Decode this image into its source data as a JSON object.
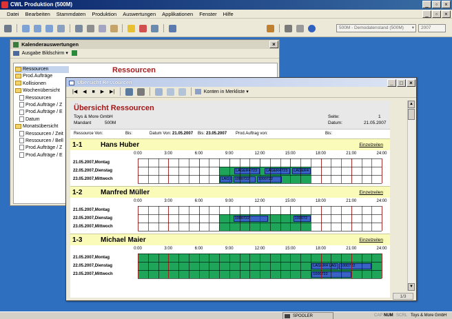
{
  "app": {
    "title": "CWL Produktion (500M)"
  },
  "menu": [
    "Datei",
    "Bearbeiten",
    "Stammdaten",
    "Produktion",
    "Auswertungen",
    "Applikationen",
    "Fenster",
    "Hilfe"
  ],
  "toolbar": {
    "database_label": "500M - Demodatenstand (500M)",
    "year": "2007"
  },
  "kalender": {
    "title": "Kalenderauswertungen",
    "output_label": "Ausgabe Bildschirm",
    "heading": "Ressourcen",
    "tree": [
      {
        "label": "Ressourcen",
        "level": 0,
        "type": "folder"
      },
      {
        "label": "Prod.Aufträge",
        "level": 0,
        "type": "folder"
      },
      {
        "label": "Kollisionen",
        "level": 0,
        "type": "folder"
      },
      {
        "label": "Wochenübersicht",
        "level": 0,
        "type": "folder"
      },
      {
        "label": "Ressourcen",
        "level": 1,
        "type": "doc"
      },
      {
        "label": "Prod.Aufträge / Z",
        "level": 1,
        "type": "doc"
      },
      {
        "label": "Prod.Aufträge / E",
        "level": 1,
        "type": "doc"
      },
      {
        "label": "Datum",
        "level": 1,
        "type": "doc"
      },
      {
        "label": "Monatsübersicht",
        "level": 0,
        "type": "folder"
      },
      {
        "label": "Ressourcen / Zeit",
        "level": 1,
        "type": "doc"
      },
      {
        "label": "Ressourcen / Bell",
        "level": 1,
        "type": "doc"
      },
      {
        "label": "Prod.Aufträge / Z",
        "level": 1,
        "type": "doc"
      },
      {
        "label": "Prod.Aufträge / E",
        "level": 1,
        "type": "doc"
      }
    ]
  },
  "uebersicht": {
    "title": "Übersicht Ressourcen",
    "toolbar_dropdown": "Konten in Merkliste",
    "page_indicator": "1/3",
    "report": {
      "title": "Übersicht Ressourcen",
      "company": "Toys & More GmbH",
      "mandant_label": "Mandant",
      "mandant_value": "500M",
      "seite_label": "Seite:",
      "seite_value": "1",
      "datum_label": "Datum:",
      "datum_value": "21.05.2007",
      "filter": {
        "ressource_von": "Ressource Von:",
        "bis": "Bis:",
        "datum_von_label": "Datum Von:",
        "datum_von": "21.05.2007",
        "bis2_label": "Bis:",
        "datum_bis": "23.05.2007",
        "prodauftrag_label": "Prod.Auftrag von:",
        "bis3": "Bis:"
      }
    },
    "time_ticks": [
      "0:00",
      "3:00",
      "6:00",
      "9:00",
      "12:00",
      "15:00",
      "18:00",
      "21:00",
      "24:00"
    ],
    "day_labels": [
      "21.05.2007,Montag",
      "22.05.2007,Dienstag",
      "23.05.2007,Mittwoch"
    ],
    "link_label": "Einzelzeilen",
    "resources": [
      {
        "num": "1-1",
        "name": "Hans Huber",
        "rows": [
          {
            "green": [],
            "bars": []
          },
          {
            "green": [
              [
                8,
                17
              ]
            ],
            "bars": [
              {
                "s": 9.5,
                "e": 12,
                "label": "LAGER4723"
              },
              {
                "s": 12.5,
                "e": 15,
                "label": "LAGER4723"
              },
              {
                "s": 15.2,
                "e": 17,
                "label": "LAGER4"
              }
            ]
          },
          {
            "green": [
              [
                8,
                17
              ]
            ],
            "bars": [
              {
                "s": 8.1,
                "e": 9.3,
                "label": "LAGER4"
              },
              {
                "s": 9.4,
                "e": 11.6,
                "label": "1000722"
              },
              {
                "s": 11.7,
                "e": 14.2,
                "label": "1000722"
              }
            ]
          }
        ]
      },
      {
        "num": "1-2",
        "name": "Manfred Müller",
        "rows": [
          {
            "green": [],
            "bars": []
          },
          {
            "green": [
              [
                8,
                17
              ]
            ],
            "bars": [
              {
                "s": 9.4,
                "e": 12.8,
                "label": "1000722"
              },
              {
                "s": 15.3,
                "e": 17,
                "label": "100072"
              }
            ]
          },
          {
            "green": [
              [
                8,
                17
              ]
            ],
            "bars": []
          }
        ]
      },
      {
        "num": "1-3",
        "name": "Michael Maier",
        "rows": [
          {
            "green": [
              [
                0,
                24
              ]
            ],
            "bars": []
          },
          {
            "green": [
              [
                0,
                24
              ]
            ],
            "bars": [
              {
                "s": 17.1,
                "e": 19.7,
                "label": "LAGER4 LAG"
              },
              {
                "s": 19.8,
                "e": 23,
                "label": "1000722"
              }
            ]
          },
          {
            "green": [
              [
                0,
                24
              ]
            ],
            "bars": [
              {
                "s": 17.1,
                "e": 21,
                "label": "1000722"
              }
            ]
          }
        ]
      }
    ]
  },
  "statusbar": {
    "spooler": "SPOOLER",
    "cap": "CAP",
    "num": "NUM",
    "scrl": "SCRL",
    "company": "Toys & More GmbH"
  },
  "colors": {
    "desktop": "#2f6fc0",
    "titlebar": "#0a246a",
    "green": "#1fa55a",
    "bar": "#3a62c4",
    "res_title": "#fafab9"
  }
}
